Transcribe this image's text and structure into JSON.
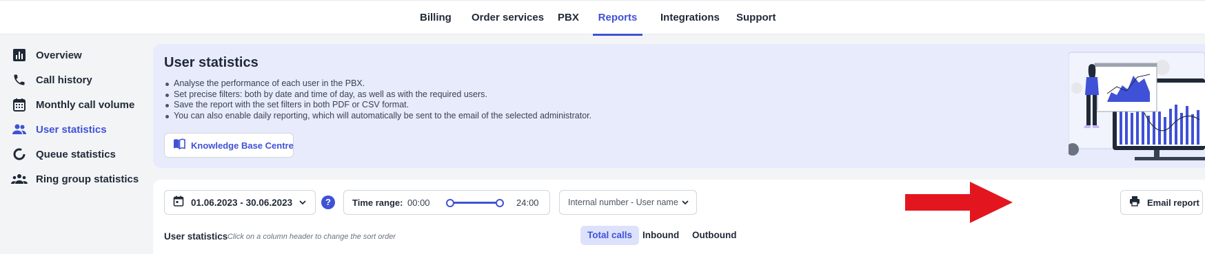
{
  "nav": {
    "items": [
      {
        "label": "Billing",
        "active": false
      },
      {
        "label": "Order services",
        "active": false
      },
      {
        "label": "PBX",
        "active": false
      },
      {
        "label": "Reports",
        "active": true
      },
      {
        "label": "Integrations",
        "active": false
      },
      {
        "label": "Support",
        "active": false
      }
    ]
  },
  "sidebar": {
    "items": [
      {
        "label": "Overview",
        "icon": "bar-chart-icon",
        "active": false
      },
      {
        "label": "Call history",
        "icon": "phone-icon",
        "active": false
      },
      {
        "label": "Monthly call volume",
        "icon": "calendar-icon",
        "active": false
      },
      {
        "label": "User statistics",
        "icon": "users-icon",
        "active": true
      },
      {
        "label": "Queue statistics",
        "icon": "donut-icon",
        "active": false
      },
      {
        "label": "Ring group statistics",
        "icon": "group-icon",
        "active": false
      }
    ]
  },
  "info": {
    "title": "User statistics",
    "bullets": [
      "Analyse the performance of each user in the PBX.",
      "Set precise filters: both by date and time of day, as well as with the required users.",
      "Save the report with the set filters in both PDF or CSV format.",
      "You can also enable daily reporting, which will automatically be sent to the email of the selected administrator."
    ],
    "kb_button": "Knowledge Base Centre"
  },
  "filters": {
    "date_range": "01.06.2023 - 30.06.2023",
    "help": "?",
    "time_label": "Time range:",
    "time_start": "00:00",
    "time_end": "24:00",
    "time_range_fraction": [
      0,
      1
    ],
    "user_placeholder": "Internal number - User name",
    "email_button": "Email report"
  },
  "stats": {
    "title": "User statistics",
    "hint": "Click on a column header to change the sort order",
    "tabs": [
      {
        "label": "Total calls",
        "active": true
      },
      {
        "label": "Inbound",
        "active": false
      },
      {
        "label": "Outbound",
        "active": false
      }
    ]
  },
  "colors": {
    "accent": "#3f51d7",
    "arrow": "#e3161f",
    "card_bg": "#e8ebfb"
  }
}
